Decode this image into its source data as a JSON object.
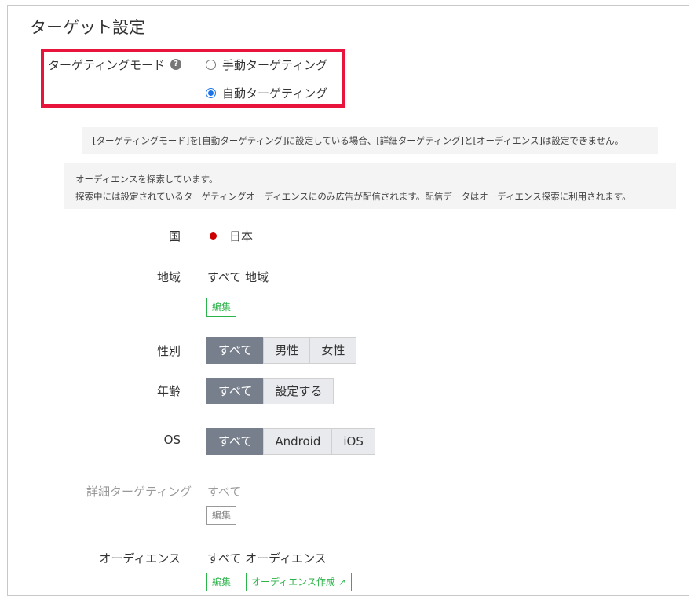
{
  "page_title": "ターゲット設定",
  "targeting_mode": {
    "label": "ターゲティングモード",
    "help": "?",
    "options": [
      {
        "label": "手動ターゲティング",
        "selected": false
      },
      {
        "label": "自動ターゲティング",
        "selected": true
      }
    ]
  },
  "notices": {
    "auto_mode": "[ターゲティングモード]を[自動ターゲティング]に設定している場合、[詳細ターゲティング]と[オーディエンス]は設定できません。",
    "exploring_line1": "オーディエンスを探索しています。",
    "exploring_line2": "探索中には設定されているターゲティングオーディエンスにのみ広告が配信されます。配信データはオーディエンス探索に利用されます。"
  },
  "country": {
    "label": "国",
    "value": "日本"
  },
  "region": {
    "label": "地域",
    "value": "すべて 地域",
    "edit": "編集"
  },
  "gender": {
    "label": "性別",
    "options": [
      "すべて",
      "男性",
      "女性"
    ],
    "selected": "すべて"
  },
  "age": {
    "label": "年齢",
    "options": [
      "すべて",
      "設定する"
    ],
    "selected": "すべて"
  },
  "os": {
    "label": "OS",
    "options": [
      "すべて",
      "Android",
      "iOS"
    ],
    "selected": "すべて"
  },
  "detailed_targeting": {
    "label": "詳細ターゲティング",
    "value": "すべて",
    "edit": "編集"
  },
  "audience": {
    "label": "オーディエンス",
    "value": "すべて オーディエンス",
    "edit": "編集",
    "create": "オーディエンス作成"
  },
  "colors": {
    "highlight": "#e8143c",
    "accent_green": "#2bb44a",
    "segment_active": "#777f8c",
    "radio_blue": "#1a73e8"
  }
}
